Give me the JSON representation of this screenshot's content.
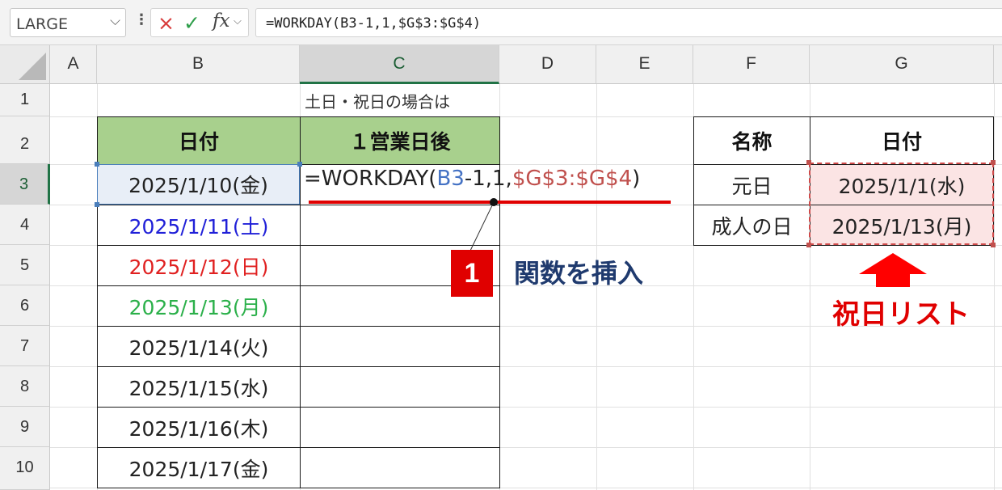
{
  "formula_bar": {
    "name_box": "LARGE",
    "cancel_icon": "×",
    "enter_icon": "✓",
    "fx_label": "fx",
    "formula": "=WORKDAY(B3-1,1,$G$3:$G$4)"
  },
  "columns": [
    "A",
    "B",
    "C",
    "D",
    "E",
    "F",
    "G"
  ],
  "rows": [
    "1",
    "2",
    "3",
    "4",
    "5",
    "6",
    "7",
    "8",
    "9",
    "10"
  ],
  "sheet": {
    "c1_note": "土日・祝日の場合は",
    "b2_header": "日付",
    "c2_header": "１営業日後",
    "dates": [
      {
        "text": "2025/1/10(金)",
        "color": "#222222"
      },
      {
        "text": "2025/1/11(土)",
        "color": "#2020d8"
      },
      {
        "text": "2025/1/12(日)",
        "color": "#e02020"
      },
      {
        "text": "2025/1/13(月)",
        "color": "#2bb04a"
      },
      {
        "text": "2025/1/14(火)",
        "color": "#222222"
      },
      {
        "text": "2025/1/15(水)",
        "color": "#222222"
      },
      {
        "text": "2025/1/16(木)",
        "color": "#222222"
      },
      {
        "text": "2025/1/17(金)",
        "color": "#222222"
      }
    ],
    "c3_formula": {
      "prefix": "=WORKDAY(",
      "ref1": "B3",
      "middle": "-1,1,",
      "ref2": "$G$3:$G$4",
      "suffix": ")"
    },
    "holiday_table": {
      "header_name": "名称",
      "header_date": "日付",
      "rows": [
        {
          "name": "元日",
          "date": "2025/1/1(水)"
        },
        {
          "name": "成人の日",
          "date": "2025/1/13(月)"
        }
      ]
    }
  },
  "annotations": {
    "step_number": "1",
    "step_label": "関数を挿入",
    "arrow_icon": "up-arrow-icon",
    "holiday_list_label": "祝日リスト"
  },
  "colors": {
    "header_green": "#a8d08d",
    "accent_red": "#e00000",
    "selection_blue": "#4a7ebb",
    "excel_green": "#217346"
  }
}
